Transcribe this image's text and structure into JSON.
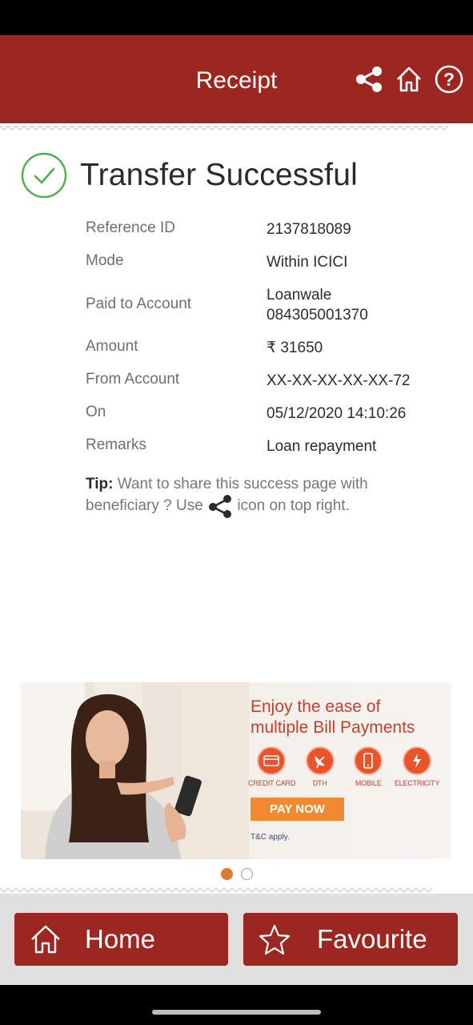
{
  "header": {
    "title": "Receipt",
    "icons": [
      "share-icon",
      "home-icon",
      "help-icon"
    ],
    "color": "#9c2620"
  },
  "status": {
    "title": "Transfer Successful",
    "icon": "check-circle-icon",
    "color": "#4caf50"
  },
  "details": [
    {
      "label": "Reference ID",
      "value": "2137818089"
    },
    {
      "label": "Mode",
      "value": "Within ICICI"
    },
    {
      "label": "Paid to Account",
      "value": "Loanwale\n084305001370"
    },
    {
      "label": "Amount",
      "value": "₹ 31650"
    },
    {
      "label": "From Account",
      "value": "XX-XX-XX-XX-XX-72"
    },
    {
      "label": "On",
      "value": "05/12/2020 14:10:26"
    },
    {
      "label": "Remarks",
      "value": "Loan repayment"
    }
  ],
  "tip": {
    "bold": "Tip:",
    "before_icon": "Want to share this success page with beneficiary ? Use",
    "after_icon": "icon on top right."
  },
  "banner": {
    "headline_1": "Enjoy the ease of",
    "headline_2": "multiple Bill Payments",
    "services": [
      "CREDIT CARD",
      "DTH",
      "MOBILE",
      "ELECTRICITY"
    ],
    "cta": "PAY NOW",
    "tnc": "T&C apply."
  },
  "carousel": {
    "active_index": 0,
    "count": 2
  },
  "footer": {
    "home_label": "Home",
    "favourite_label": "Favourite"
  }
}
